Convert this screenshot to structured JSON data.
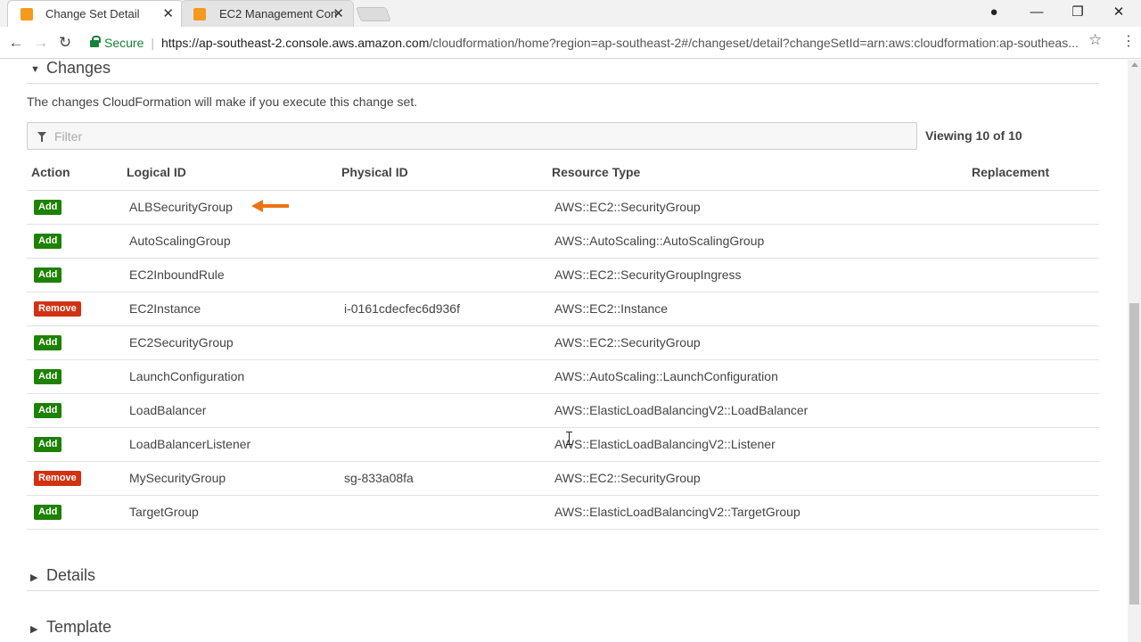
{
  "browser": {
    "tabs": [
      {
        "title": "Change Set Detail",
        "close": "✕",
        "active": true
      },
      {
        "title": "EC2 Management Console",
        "close": "✕",
        "active": false
      }
    ],
    "window_controls": {
      "profile": "●",
      "minimize": "—",
      "restore": "❐",
      "close": "✕"
    },
    "nav": {
      "back": "←",
      "forward": "→",
      "reload": "↻"
    },
    "secure_label": "Secure",
    "url_host": "https://ap-southeast-2.console.aws.amazon.com",
    "url_path": "/cloudformation/home?region=ap-southeast-2#/changeset/detail?changeSetId=arn:aws:cloudformation:ap-southeas...",
    "bookmark_icon": "☆",
    "menu_icon": "⋮"
  },
  "changes": {
    "section_title": "Changes",
    "description": "The changes CloudFormation will make if you execute this change set.",
    "filter_placeholder": "Filter",
    "viewing": "Viewing 10 of 10",
    "columns": {
      "action": "Action",
      "logical_id": "Logical ID",
      "physical_id": "Physical ID",
      "resource_type": "Resource Type",
      "replacement": "Replacement"
    },
    "rows": [
      {
        "action": "Add",
        "logical_id": "ALBSecurityGroup",
        "physical_id": "",
        "resource_type": "AWS::EC2::SecurityGroup",
        "replacement": ""
      },
      {
        "action": "Add",
        "logical_id": "AutoScalingGroup",
        "physical_id": "",
        "resource_type": "AWS::AutoScaling::AutoScalingGroup",
        "replacement": ""
      },
      {
        "action": "Add",
        "logical_id": "EC2InboundRule",
        "physical_id": "",
        "resource_type": "AWS::EC2::SecurityGroupIngress",
        "replacement": ""
      },
      {
        "action": "Remove",
        "logical_id": "EC2Instance",
        "physical_id": "i-0161cdecfec6d936f",
        "resource_type": "AWS::EC2::Instance",
        "replacement": ""
      },
      {
        "action": "Add",
        "logical_id": "EC2SecurityGroup",
        "physical_id": "",
        "resource_type": "AWS::EC2::SecurityGroup",
        "replacement": ""
      },
      {
        "action": "Add",
        "logical_id": "LaunchConfiguration",
        "physical_id": "",
        "resource_type": "AWS::AutoScaling::LaunchConfiguration",
        "replacement": ""
      },
      {
        "action": "Add",
        "logical_id": "LoadBalancer",
        "physical_id": "",
        "resource_type": "AWS::ElasticLoadBalancingV2::LoadBalancer",
        "replacement": ""
      },
      {
        "action": "Add",
        "logical_id": "LoadBalancerListener",
        "physical_id": "",
        "resource_type": "AWS::ElasticLoadBalancingV2::Listener",
        "replacement": ""
      },
      {
        "action": "Remove",
        "logical_id": "MySecurityGroup",
        "physical_id": "sg-833a08fa",
        "resource_type": "AWS::EC2::SecurityGroup",
        "replacement": ""
      },
      {
        "action": "Add",
        "logical_id": "TargetGroup",
        "physical_id": "",
        "resource_type": "AWS::ElasticLoadBalancingV2::TargetGroup",
        "replacement": ""
      }
    ]
  },
  "details": {
    "section_title": "Details"
  },
  "template": {
    "section_title": "Template"
  },
  "colors": {
    "add": "#1d8102",
    "remove": "#d13212",
    "arrow": "#ec7211"
  }
}
